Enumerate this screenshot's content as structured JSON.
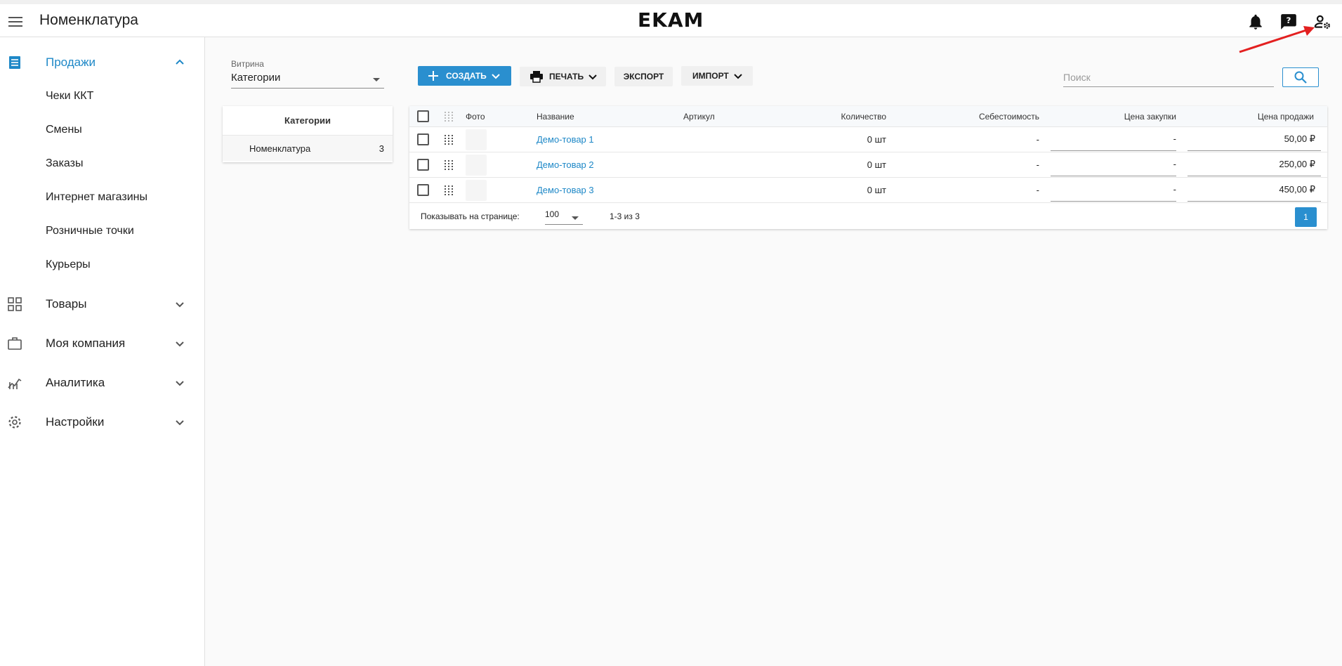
{
  "header": {
    "title": "Номенклатура",
    "logo": "EKAM"
  },
  "sidebar": {
    "sales": {
      "label": "Продажи",
      "items": [
        "Чеки ККТ",
        "Смены",
        "Заказы",
        "Интернет магазины",
        "Розничные точки",
        "Курьеры"
      ]
    },
    "sections": [
      {
        "label": "Товары"
      },
      {
        "label": "Моя компания"
      },
      {
        "label": "Аналитика"
      },
      {
        "label": "Настройки"
      }
    ]
  },
  "vitrina": {
    "label": "Витрина",
    "value": "Категории"
  },
  "categories": {
    "header": "Категории",
    "rows": [
      {
        "name": "Номенклатура",
        "count": "3"
      }
    ]
  },
  "toolbar": {
    "create": "СОЗДАТЬ",
    "print": "ПЕЧАТЬ",
    "export": "ЭКСПОРТ",
    "import": "ИМПОРТ"
  },
  "search": {
    "placeholder": "Поиск"
  },
  "table": {
    "columns": {
      "photo": "Фото",
      "name": "Название",
      "sku": "Артикул",
      "qty": "Количество",
      "cost": "Себестоимость",
      "purchase": "Цена закупки",
      "price": "Цена продажи"
    },
    "rows": [
      {
        "name": "Демо-товар 1",
        "sku": "",
        "qty": "0 шт",
        "cost": "-",
        "purchase": "-",
        "price": "50,00 ₽"
      },
      {
        "name": "Демо-товар 2",
        "sku": "",
        "qty": "0 шт",
        "cost": "-",
        "purchase": "-",
        "price": "250,00 ₽"
      },
      {
        "name": "Демо-товар 3",
        "sku": "",
        "qty": "0 шт",
        "cost": "-",
        "purchase": "-",
        "price": "450,00 ₽"
      }
    ],
    "footer": {
      "per_page_label": "Показывать на странице:",
      "per_page": "100",
      "range": "1-3 из 3",
      "page": "1"
    }
  },
  "colors": {
    "accent": "#2a8fcf",
    "link": "#1e88c7",
    "annotation_arrow": "#e32020"
  },
  "icons": [
    "menu-icon",
    "bell-icon",
    "help-icon",
    "user-settings-icon",
    "receipt-icon",
    "grid-icon",
    "briefcase-icon",
    "analytics-icon",
    "gear-icon",
    "chevron-up-icon",
    "chevron-down-icon",
    "plus-icon",
    "printer-icon",
    "search-icon",
    "drag-handle-icon"
  ]
}
